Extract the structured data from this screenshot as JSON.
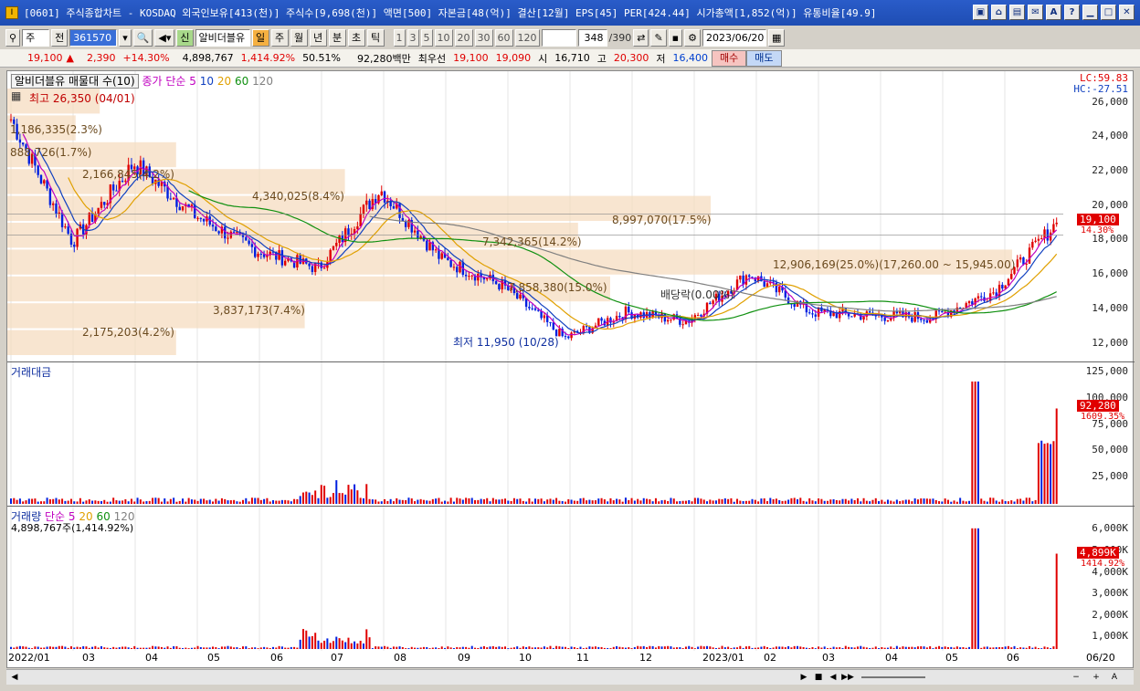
{
  "window": {
    "title": "[0601] 주식종합차트 - KOSDAQ 외국인보유[413(천)] 주식수[9,698(천)] 액면[500] 자본금[48(억)] 결산[12월] EPS[45] PER[424.44] 시가총액[1,852(억)] 유통비율[49.9]",
    "app_icon": "I",
    "buttons": [
      "▣",
      "⌂",
      "▤",
      "✉",
      "A",
      "?",
      "▁",
      "□",
      "✕"
    ]
  },
  "toolbar": {
    "type_select": "주",
    "prev": "전",
    "code": "361570",
    "name": "알비더블유",
    "name_prefix": "신",
    "periods": [
      "일",
      "주",
      "월",
      "년",
      "분",
      "초",
      "틱"
    ],
    "selected_period": "일",
    "numbers": [
      "1",
      "3",
      "5",
      "10",
      "20",
      "30",
      "60",
      "120"
    ],
    "count": "348",
    "count_total": "/390",
    "date": "2023/06/20"
  },
  "quote": {
    "price": "19,100",
    "arrow": "▲",
    "change": "2,390",
    "pct": "+14.30%",
    "volume": "4,898,767",
    "vol_pct": "1,414.92%",
    "ratio": "50.51%",
    "amount": "92,280백만",
    "bid_label": "최우선",
    "bid1": "19,100",
    "bid2": "19,090",
    "open_label": "시",
    "open": "16,710",
    "high_label": "고",
    "high": "20,300",
    "low_label": "저",
    "low": "16,400",
    "buy_label": "매수",
    "sell_label": "매도"
  },
  "price_pane": {
    "legend_name": "알비더블유 매물대 수(10)",
    "legend_ma": "종가 단순",
    "ma_periods": [
      "5",
      "10",
      "20",
      "60",
      "120"
    ],
    "ma_colors": [
      "#c000c0",
      "#1040c0",
      "#e0a000",
      "#109010",
      "#808080"
    ],
    "lc": "LC:59.83",
    "hc": "HC:-27.51",
    "high_note": "최고 26,350 (04/01)",
    "low_note": "최저 11,950 (10/28)",
    "dividend_note": "배당락(0.00%)",
    "yticks": [
      "26,000",
      "24,000",
      "22,000",
      "20,000",
      "18,000",
      "16,000",
      "14,000",
      "12,000"
    ],
    "current_tag": "19,100",
    "current_sub": "14.30%",
    "volume_profile": [
      "2,175,203(4.2%)",
      "3,837,173(7.4%)",
      "7,858,380(15.0%)",
      "12,906,169(25.0%)(17,260.00 ~ 15,945.00)",
      "7,342,365(14.2%)",
      "8,997,070(17.5%)",
      "4,340,025(8.4%)",
      "2,166,845(4.2%)",
      "888,726(1.7%)",
      "1,186,335(2.3%)"
    ]
  },
  "amount_pane": {
    "legend": "거래대금",
    "yticks": [
      "125,000",
      "100,000",
      "75,000",
      "50,000",
      "25,000"
    ],
    "current_tag": "92,280",
    "current_sub": "1609.35%"
  },
  "volume_pane": {
    "legend_name": "거래량",
    "legend_ma": "단순",
    "ma_periods": [
      "5",
      "20",
      "60",
      "120"
    ],
    "note": "4,898,767주(1,414.92%)",
    "yticks": [
      "6,000K",
      "5,000K",
      "4,000K",
      "3,000K",
      "2,000K",
      "1,000K"
    ],
    "current_tag": "4,899K",
    "current_sub": "1414.92%"
  },
  "xaxis": {
    "labels": [
      "2022/01",
      "03",
      "04",
      "05",
      "06",
      "07",
      "08",
      "09",
      "10",
      "11",
      "12",
      "2023/01",
      "02",
      "03",
      "04",
      "05",
      "06"
    ],
    "right_label": "06/20"
  },
  "scroll": {
    "buttons": [
      "◀",
      "▶",
      "■",
      "◀",
      "▶▶",
      "−",
      "+",
      "A"
    ]
  },
  "chart_data": {
    "type": "candlestick",
    "title": "",
    "ylim": [
      11500,
      26800
    ],
    "x": [
      "2022/01",
      "03",
      "04",
      "05",
      "06",
      "07",
      "08",
      "09",
      "10",
      "11",
      "12",
      "2023/01",
      "02",
      "03",
      "04",
      "05",
      "06"
    ],
    "series": [
      {
        "name": "종가",
        "values": [
          25000,
          18000,
          22500,
          19500,
          17500,
          16500,
          21000,
          17000,
          15500,
          12500,
          14000,
          13500,
          16200,
          14000,
          13800,
          13700,
          15200,
          19100
        ]
      }
    ],
    "volume_profile_pct": [
      4.2,
      7.4,
      15.0,
      25.0,
      14.2,
      17.5,
      8.4,
      4.2,
      1.7,
      2.3
    ],
    "current_price": 19100,
    "high": 26350,
    "low": 11950
  }
}
